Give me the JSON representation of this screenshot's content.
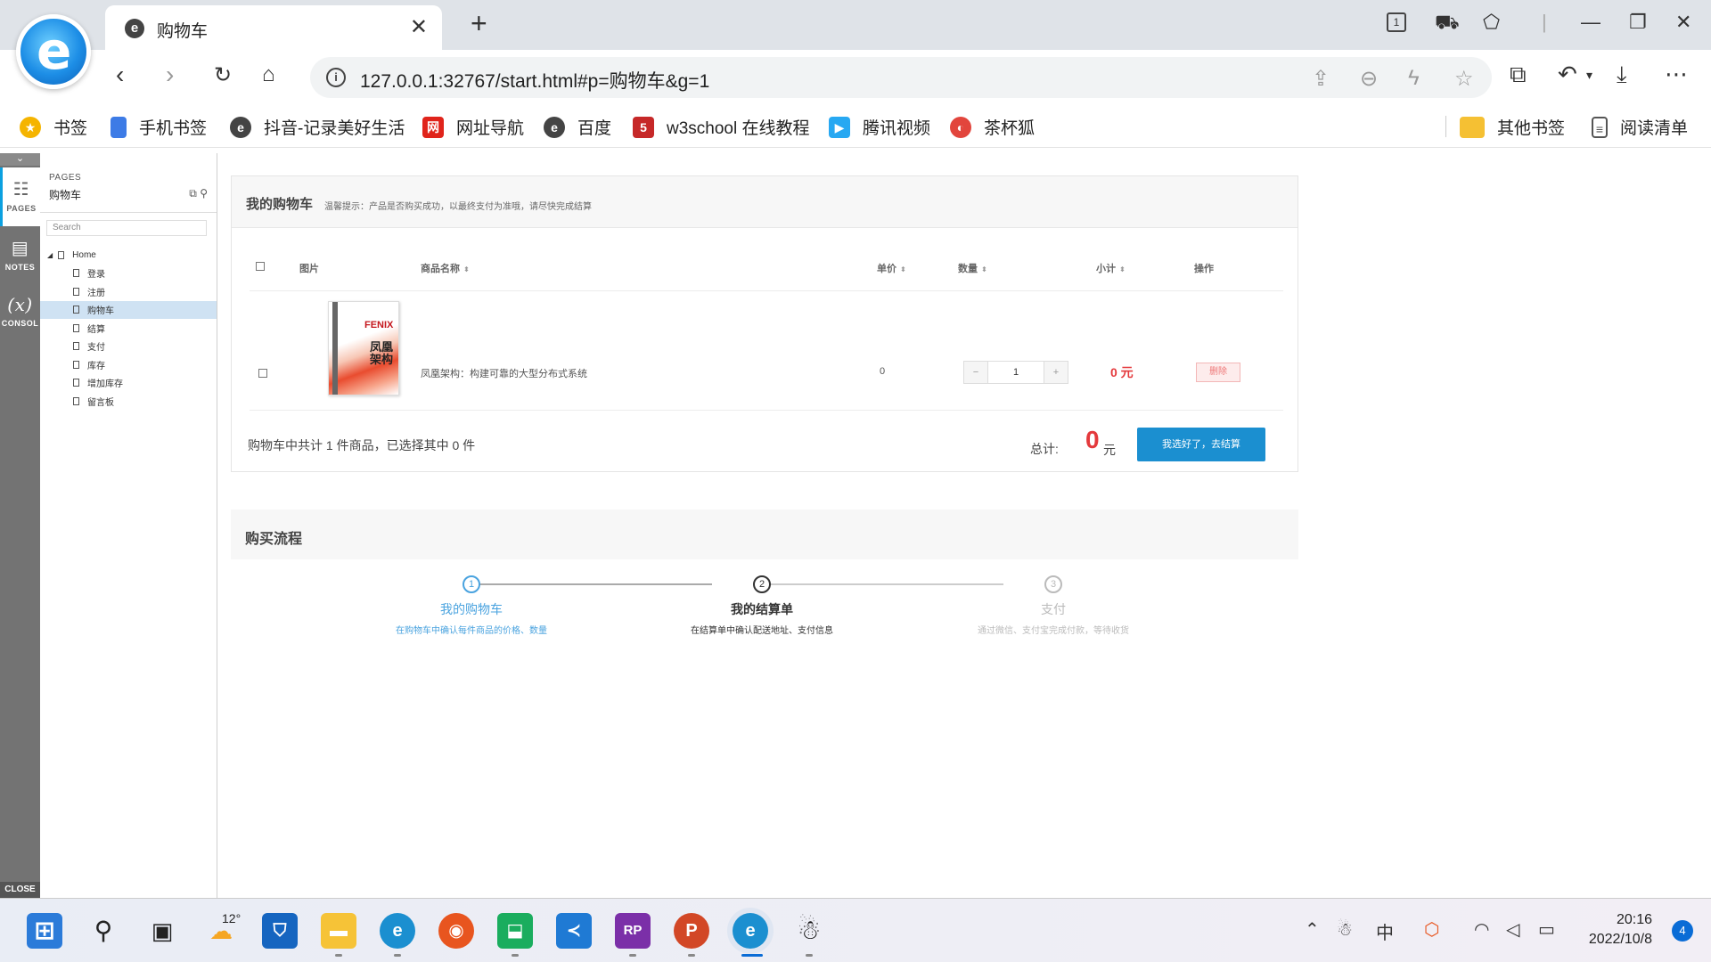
{
  "browser": {
    "tab_title": "购物车",
    "tab_close": "✕",
    "new_tab": "+",
    "url": "127.0.0.1:32767/start.html#p=购物车&g=1",
    "window_controls": {
      "tab_count": "1",
      "minimize": "—",
      "restore": "❐",
      "close": "✕"
    }
  },
  "bookmarks": [
    {
      "label": "书签",
      "icon": "star-icon",
      "color": "#f5b400"
    },
    {
      "label": "手机书签",
      "icon": "phone-icon",
      "color": "#3d7be6"
    },
    {
      "label": "抖音-记录美好生活",
      "icon": "ie-icon",
      "color": "#444444"
    },
    {
      "label": "网址导航",
      "icon": "nav-icon",
      "color": "#e0241b"
    },
    {
      "label": "百度",
      "icon": "ie-icon",
      "color": "#444444"
    },
    {
      "label": "w3school 在线教程",
      "icon": "w3-icon",
      "color": "#c62828"
    },
    {
      "label": "腾讯视频",
      "icon": "play-icon",
      "color": "#27a8f2"
    },
    {
      "label": "茶杯狐",
      "icon": "fox-icon",
      "color": "#e2453c"
    },
    {
      "label": "其他书签",
      "icon": "folder-icon",
      "color": "#f5c033"
    },
    {
      "label": "阅读清单",
      "icon": "list-icon",
      "color": "#555555"
    }
  ],
  "sidebar": {
    "rail": {
      "pages": "PAGES",
      "notes": "NOTES",
      "console": "CONSOL",
      "close": "CLOSE",
      "collapse": "⌄"
    },
    "panel_heading": "PAGES",
    "current_page": "购物车",
    "search_placeholder": "Search",
    "tree": {
      "root": "Home",
      "children": [
        "登录",
        "注册",
        "购物车",
        "结算",
        "支付",
        "库存",
        "增加库存",
        "留言板"
      ]
    }
  },
  "cart": {
    "title": "我的购物车",
    "tip": "温馨提示：产品是否购买成功，以最终支付为准哦，请尽快完成结算",
    "columns": [
      "图片",
      "商品名称",
      "单价",
      "数量",
      "小计",
      "操作"
    ],
    "items": [
      {
        "name": "凤凰架构：构建可靠的大型分布式系统",
        "price": "0",
        "qty": "1",
        "subtotal": "0 元",
        "delete_label": "删除",
        "cover_title": "FENIX",
        "cover_cn": "凤凰架构"
      }
    ],
    "qty_minus": "−",
    "qty_plus": "+",
    "summary": "购物车中共计 1 件商品，已选择其中 0 件",
    "total_label": "总计:",
    "total_value": "0",
    "total_unit": "元",
    "checkout_label": "我选好了，去结算"
  },
  "flow": {
    "title": "购买流程",
    "steps": [
      {
        "num": "1",
        "label": "我的购物车",
        "desc": "在购物车中确认每件商品的价格、数量",
        "color": "#4aa3df"
      },
      {
        "num": "2",
        "label": "我的结算单",
        "desc": "在结算单中确认配送地址、支付信息",
        "color": "#333333"
      },
      {
        "num": "3",
        "label": "支付",
        "desc": "通过微信、支付宝完成付款，等待收货",
        "color": "#bbbbbb"
      }
    ]
  },
  "taskbar": {
    "weather_temp": "12°",
    "tray_ime": "中",
    "time": "20:16",
    "date": "2022/10/8",
    "notifications": "4"
  }
}
